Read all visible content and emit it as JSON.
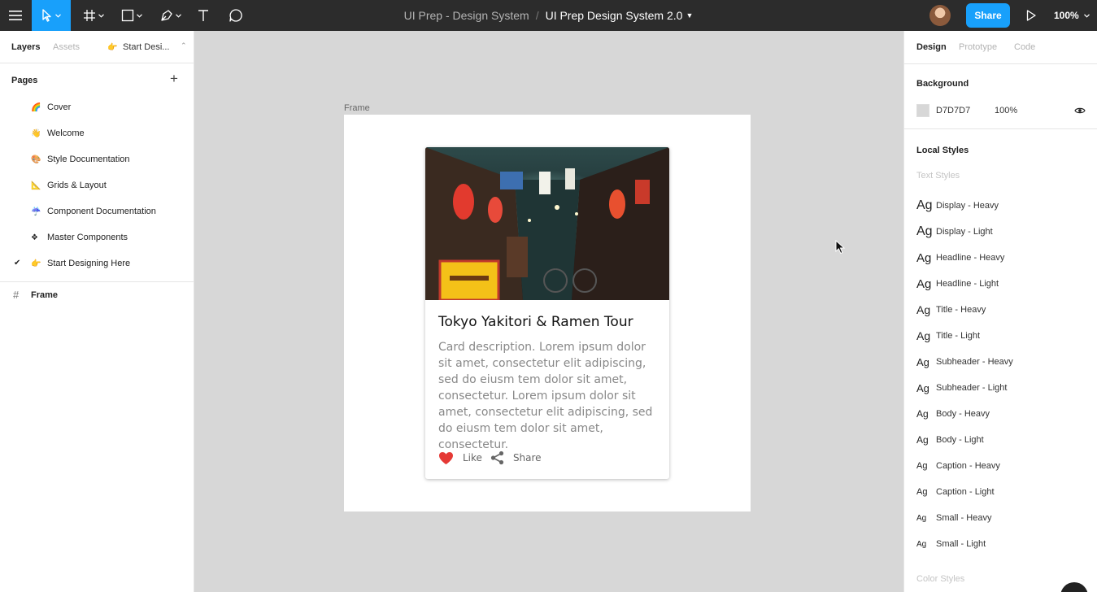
{
  "toolbar": {
    "project_name": "UI Prep - Design System",
    "separator": "/",
    "file_name": "UI Prep Design System 2.0",
    "share_label": "Share",
    "zoom": "100%",
    "icons": [
      "menu-icon",
      "move-tool-icon",
      "frame-tool-icon",
      "shape-tool-icon",
      "pen-tool-icon",
      "text-tool-icon",
      "comment-tool-icon",
      "play-icon"
    ]
  },
  "left_panel": {
    "tabs": {
      "layers": "Layers",
      "assets": "Assets"
    },
    "current_page": "Start Desi...",
    "current_page_emoji": "👉",
    "pages_title": "Pages",
    "pages": [
      {
        "emoji": "🌈",
        "label": "Cover"
      },
      {
        "emoji": "👋",
        "label": "Welcome"
      },
      {
        "emoji": "🎨",
        "label": "Style Documentation"
      },
      {
        "emoji": "📐",
        "label": "Grids & Layout"
      },
      {
        "emoji": "☔",
        "label": "Component Documentation"
      },
      {
        "emoji": "❖",
        "label": "Master Components"
      },
      {
        "emoji": "👉",
        "label": "Start Designing Here",
        "selected": true
      }
    ],
    "layers": [
      {
        "label": "Frame"
      }
    ]
  },
  "canvas": {
    "background": "#d7d7d7",
    "frame_label": "Frame",
    "card": {
      "title": "Tokyo Yakitori & Ramen Tour",
      "description": "Card description. Lorem ipsum dolor sit amet, consectetur elit adipiscing, sed do eiusm tem dolor sit amet, consectetur. Lorem ipsum dolor sit amet, consectetur elit adipiscing, sed do eiusm tem dolor sit amet, consectetur.",
      "like_label": "Like",
      "share_label": "Share",
      "like_color": "#e53935"
    }
  },
  "right_panel": {
    "tabs": {
      "design": "Design",
      "prototype": "Prototype",
      "code": "Code"
    },
    "background": {
      "title": "Background",
      "hex": "D7D7D7",
      "opacity": "100%"
    },
    "local_styles_title": "Local Styles",
    "text_styles_label": "Text Styles",
    "text_styles": [
      {
        "sample": "Ag",
        "name": "Display - Heavy"
      },
      {
        "sample": "Ag",
        "name": "Display - Light"
      },
      {
        "sample": "Ag",
        "name": "Headline - Heavy"
      },
      {
        "sample": "Ag",
        "name": "Headline - Light"
      },
      {
        "sample": "Ag",
        "name": "Title - Heavy"
      },
      {
        "sample": "Ag",
        "name": "Title - Light"
      },
      {
        "sample": "Ag",
        "name": "Subheader - Heavy"
      },
      {
        "sample": "Ag",
        "name": "Subheader - Light"
      },
      {
        "sample": "Ag",
        "name": "Body - Heavy"
      },
      {
        "sample": "Ag",
        "name": "Body - Light"
      },
      {
        "sample": "Ag",
        "name": "Caption - Heavy"
      },
      {
        "sample": "Ag",
        "name": "Caption - Light"
      },
      {
        "sample": "Ag",
        "name": "Small - Heavy"
      },
      {
        "sample": "Ag",
        "name": "Small - Light"
      }
    ],
    "color_styles_label": "Color Styles"
  },
  "colors": {
    "accent": "#18a0fb",
    "toolbar": "#2c2c2c"
  }
}
